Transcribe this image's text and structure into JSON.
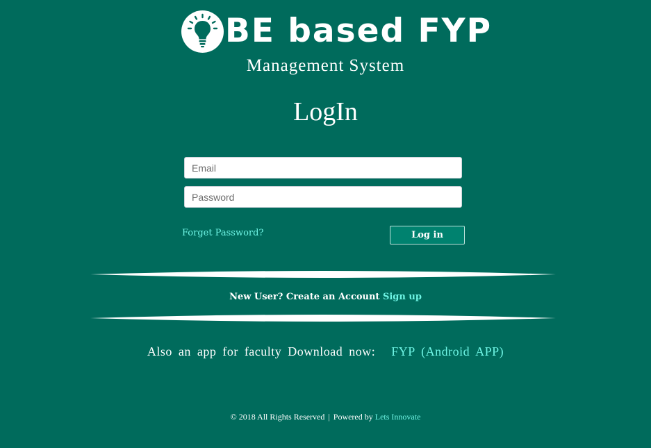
{
  "brand": {
    "name": "OBE based FYP",
    "display_name": "BE based FYP",
    "subtitle": "Management System",
    "logo_icon": "lightbulb-icon"
  },
  "login": {
    "title": "LogIn",
    "email_placeholder": "Email",
    "password_placeholder": "Password",
    "forgot_label": "Forget Password?",
    "button_label": "Log in"
  },
  "signup": {
    "text": "New User? Create an Account",
    "link_label": "Sign up"
  },
  "app": {
    "text": "Also an app for faculty Download now:",
    "link_label": "FYP (Android APP)"
  },
  "footer": {
    "copyright": "© 2018 All Rights Reserved",
    "separator": "|",
    "powered_by": "Powered by",
    "company": "Lets Innovate"
  },
  "colors": {
    "background": "#006b5c",
    "accent_link": "#6ff5e5",
    "button_bg": "#00826f",
    "text": "#ffffff"
  }
}
